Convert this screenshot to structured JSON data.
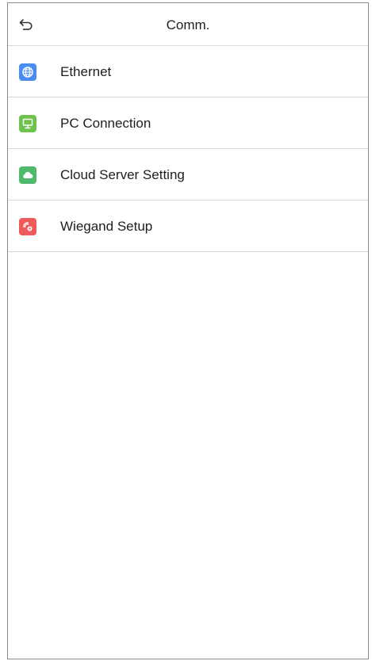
{
  "header": {
    "title": "Comm.",
    "back_icon": "back-arrow-icon"
  },
  "menu": {
    "items": [
      {
        "label": "Ethernet",
        "icon": "globe-icon",
        "color": "#4a8df0"
      },
      {
        "label": "PC Connection",
        "icon": "monitor-icon",
        "color": "#6cc24a"
      },
      {
        "label": "Cloud Server Setting",
        "icon": "cloud-icon",
        "color": "#4fba6b"
      },
      {
        "label": "Wiegand Setup",
        "icon": "signal-gear-icon",
        "color": "#ef5a5a"
      }
    ]
  }
}
